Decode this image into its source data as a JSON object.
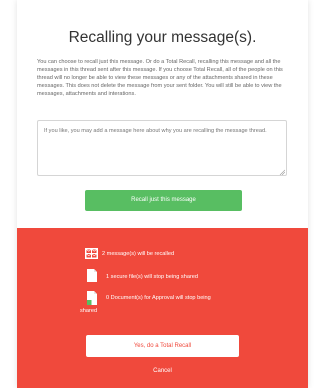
{
  "dialog": {
    "title": "Recalling your message(s).",
    "intro": "You can choose to recall just this message. Or do a Total Recall, recalling this message and all the messages in this thread sent after this message. If you choose Total Recall, all of the people on this thread will no longer be able to view these messages or any of the attachments shared in these messages. This does not delete the message from your sent folder. You will still be able to view the messages, attachments and interations.",
    "message_placeholder": "If you like, you may add a message here about why you are recalling the message thread.",
    "recall_button_label": "Recall just this message"
  },
  "total_recall": {
    "messages_text": "2 message(s) will be recalled",
    "files_text": "1 secure file(s) will stop being shared",
    "approval_text_line1": "0 Document(s) for Approval will stop being",
    "approval_text_line2": "shared",
    "confirm_button_label": "Yes, do a Total Recall",
    "cancel_label": "Cancel"
  },
  "colors": {
    "accent_green": "#58be62",
    "danger_red": "#f0493c"
  },
  "icons": {
    "messages": "messages-stack-icon",
    "file": "document-icon",
    "approval": "approval-document-icon"
  }
}
